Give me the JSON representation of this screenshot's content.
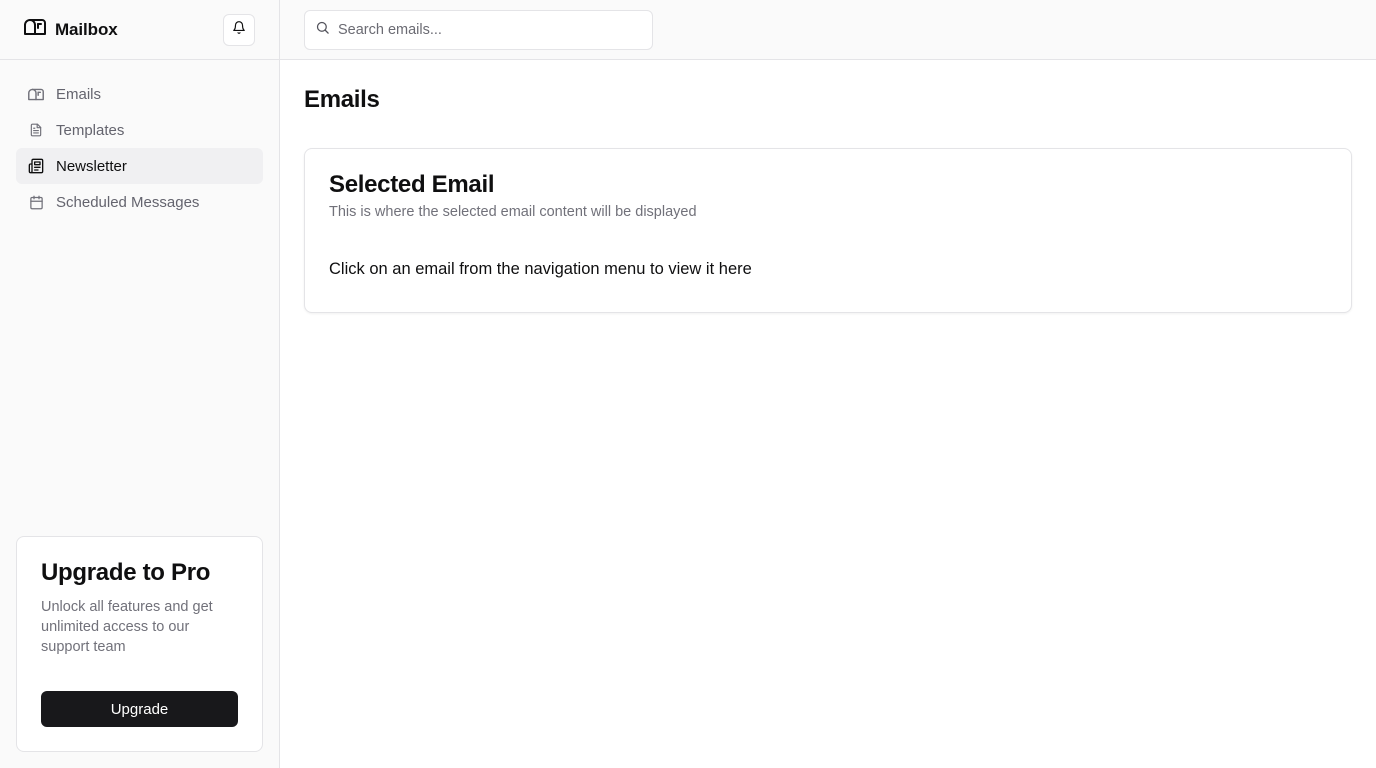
{
  "brand": {
    "name": "Mailbox",
    "icon": "mailbox-icon"
  },
  "header": {
    "notifications_icon": "bell-icon"
  },
  "sidebar": {
    "items": [
      {
        "label": "Emails",
        "icon": "mail-icon",
        "active": false
      },
      {
        "label": "Templates",
        "icon": "file-text-icon",
        "active": false
      },
      {
        "label": "Newsletter",
        "icon": "newspaper-icon",
        "active": true
      },
      {
        "label": "Scheduled Messages",
        "icon": "calendar-icon",
        "active": false
      }
    ]
  },
  "promo": {
    "title": "Upgrade to Pro",
    "text": "Unlock all features and get unlimited access to our support team",
    "button_label": "Upgrade"
  },
  "search": {
    "placeholder": "Search emails...",
    "value": ""
  },
  "main": {
    "title": "Emails",
    "card": {
      "title": "Selected Email",
      "subtitle": "This is where the selected email content will be displayed",
      "body": "Click on an email from the navigation menu to view it here"
    }
  },
  "colors": {
    "accent": "#18181b",
    "sidebar_bg": "#fafafa",
    "active_item_bg": "#f0f0f2",
    "border": "#e4e4e7",
    "muted_text": "#71717a"
  }
}
